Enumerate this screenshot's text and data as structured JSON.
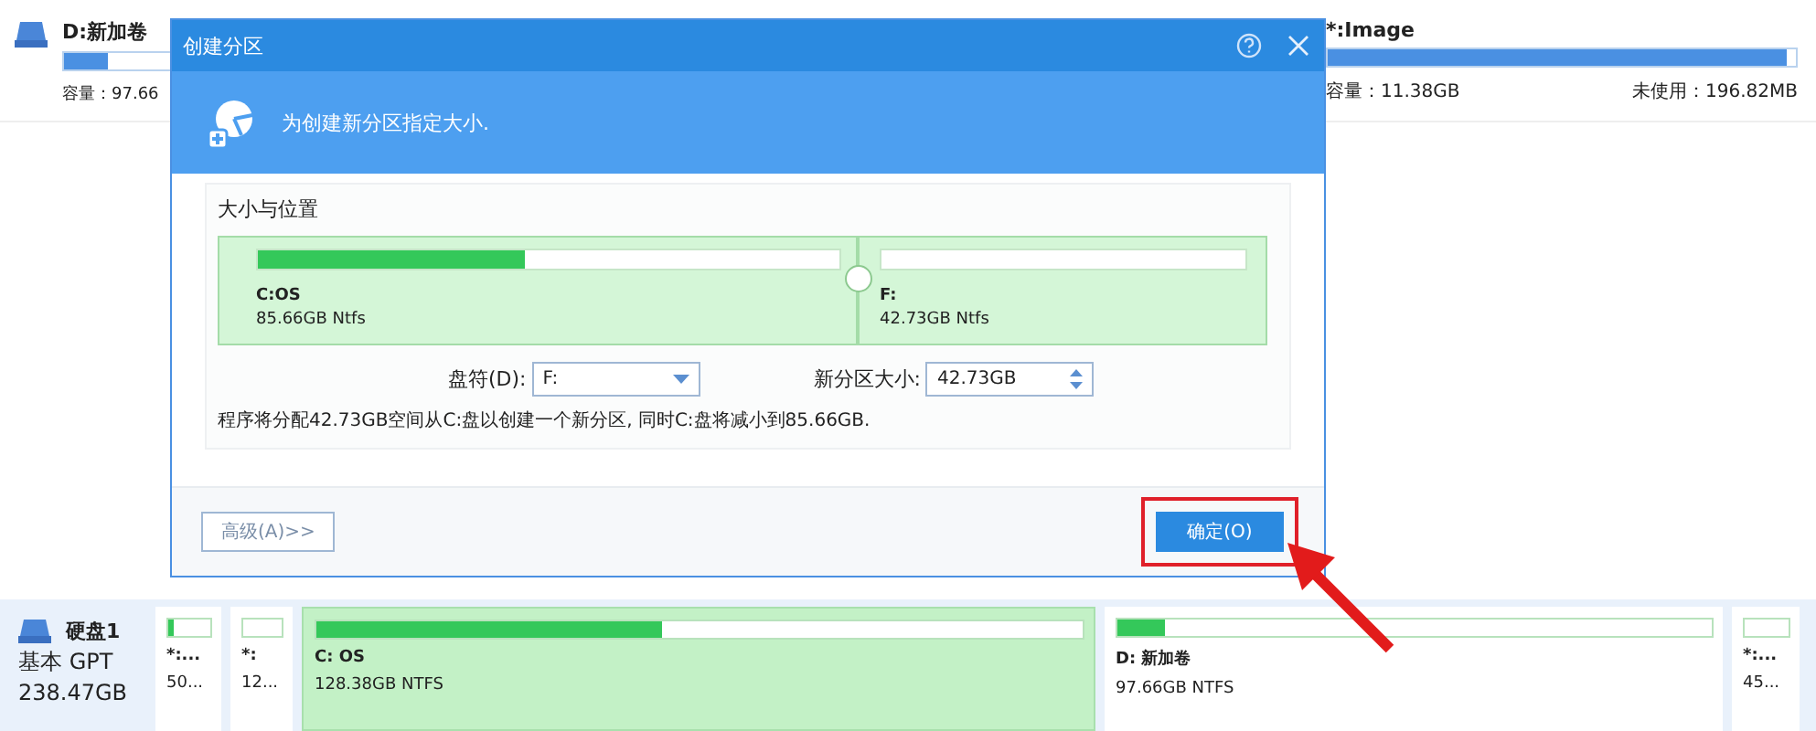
{
  "volumes": [
    {
      "name": "D:新加卷",
      "level": 0.08,
      "capacity": "容量：97.66"
    },
    {
      "name": "*:Image",
      "level": 0.98,
      "capacity": "容量：11.38GB",
      "unused": "未使用：196.82MB"
    }
  ],
  "disk_map": {
    "disk": {
      "name": "硬盘1",
      "type": "基本 GPT",
      "size": "238.47GB"
    },
    "partitions": [
      {
        "name": "*:...",
        "size": "50...",
        "level": 0.15,
        "selected": false
      },
      {
        "name": "*:",
        "size": "12...",
        "selected": false
      },
      {
        "name": "C: OS",
        "size": "128.38GB NTFS",
        "level": 0.45,
        "selected": true
      },
      {
        "name": "D: 新加卷",
        "size": "97.66GB NTFS",
        "level": 0.08,
        "selected": false
      },
      {
        "name": "*:...",
        "size": "45...",
        "selected": false
      }
    ]
  },
  "dialog": {
    "title": "创建分区",
    "header": "为创建新分区指定大小.",
    "group_title": "大小与位置",
    "partitions": [
      {
        "name": "C:OS",
        "detail": "85.66GB Ntfs",
        "level": 0.46
      },
      {
        "name": "F:",
        "detail": "42.73GB Ntfs"
      }
    ],
    "drive_letter": {
      "label": "盘符(D):",
      "value": "F:"
    },
    "size": {
      "label": "新分区大小:",
      "value": "42.73GB"
    },
    "description": "程序将分配42.73GB空间从C:盘以创建一个新分区, 同时C:盘将减小到85.66GB.",
    "buttons": [
      {
        "label": "高级(A)>>",
        "kind": "secondary",
        "highlighted": false
      },
      {
        "label": "确定(O)",
        "kind": "primary",
        "highlighted": true
      }
    ]
  }
}
